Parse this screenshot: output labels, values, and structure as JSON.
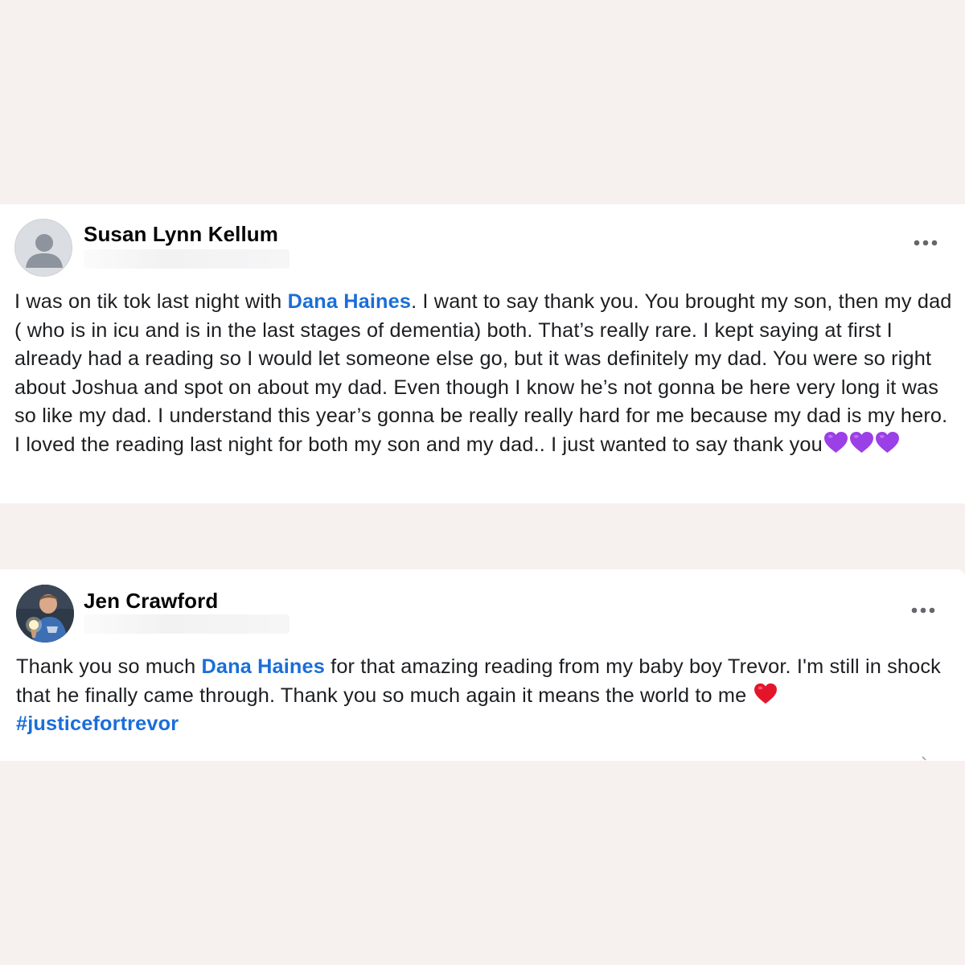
{
  "colors": {
    "page_background": "#f6f0ef",
    "card_background": "#ffffff",
    "link_blue": "#1a6ed8",
    "text": "#1c1e21",
    "purple_heart": "#9b3fe6",
    "red_heart": "#e4152b"
  },
  "posts": [
    {
      "author": "Susan Lynn Kellum",
      "avatar": "default-profile-silhouette-icon",
      "more_icon": "more-options-icon",
      "body": {
        "prefix": "I was on tik tok last night with ",
        "mention": "Dana Haines",
        "suffix": ". I want to say thank you. You brought my son, then my dad ( who is in icu and is in the last stages of dementia) both. That’s really rare. I kept saying at first I already had a reading so I would let someone else go, but it was definitely my dad. You were so right about Joshua and spot on about my dad. Even though I know he’s not gonna be here very long it was so like my dad. I understand this year’s gonna be really really hard for me because my dad is my hero. I loved the reading last night for both my son and my dad.. I just wanted to say thank you",
        "emoji": [
          "purple-heart-icon",
          "purple-heart-icon",
          "purple-heart-icon"
        ]
      }
    },
    {
      "author": "Jen Crawford",
      "avatar": "profile-photo-icon",
      "more_icon": "more-options-icon",
      "body": {
        "prefix": "Thank you so much ",
        "mention": "Dana Haines",
        "suffix": " for that amazing reading from my baby boy Trevor. I'm still in shock that he finally came through. Thank you so much again it means the world to me ",
        "emoji": [
          "red-heart-icon"
        ],
        "hashtag": "#justicefortrevor"
      }
    }
  ]
}
